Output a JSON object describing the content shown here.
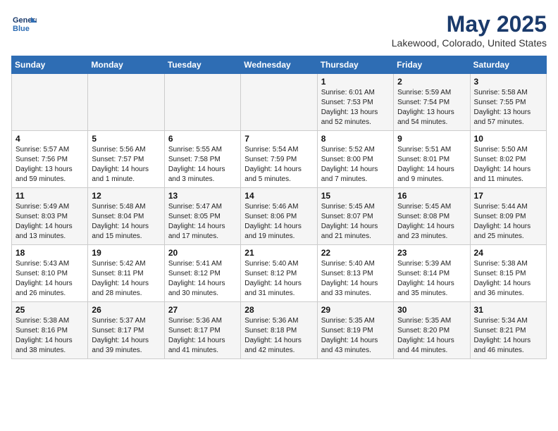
{
  "header": {
    "logo_line1": "General",
    "logo_line2": "Blue",
    "title": "May 2025",
    "subtitle": "Lakewood, Colorado, United States"
  },
  "days_of_week": [
    "Sunday",
    "Monday",
    "Tuesday",
    "Wednesday",
    "Thursday",
    "Friday",
    "Saturday"
  ],
  "weeks": [
    [
      {
        "day": "",
        "info": ""
      },
      {
        "day": "",
        "info": ""
      },
      {
        "day": "",
        "info": ""
      },
      {
        "day": "",
        "info": ""
      },
      {
        "day": "1",
        "info": "Sunrise: 6:01 AM\nSunset: 7:53 PM\nDaylight: 13 hours\nand 52 minutes."
      },
      {
        "day": "2",
        "info": "Sunrise: 5:59 AM\nSunset: 7:54 PM\nDaylight: 13 hours\nand 54 minutes."
      },
      {
        "day": "3",
        "info": "Sunrise: 5:58 AM\nSunset: 7:55 PM\nDaylight: 13 hours\nand 57 minutes."
      }
    ],
    [
      {
        "day": "4",
        "info": "Sunrise: 5:57 AM\nSunset: 7:56 PM\nDaylight: 13 hours\nand 59 minutes."
      },
      {
        "day": "5",
        "info": "Sunrise: 5:56 AM\nSunset: 7:57 PM\nDaylight: 14 hours\nand 1 minute."
      },
      {
        "day": "6",
        "info": "Sunrise: 5:55 AM\nSunset: 7:58 PM\nDaylight: 14 hours\nand 3 minutes."
      },
      {
        "day": "7",
        "info": "Sunrise: 5:54 AM\nSunset: 7:59 PM\nDaylight: 14 hours\nand 5 minutes."
      },
      {
        "day": "8",
        "info": "Sunrise: 5:52 AM\nSunset: 8:00 PM\nDaylight: 14 hours\nand 7 minutes."
      },
      {
        "day": "9",
        "info": "Sunrise: 5:51 AM\nSunset: 8:01 PM\nDaylight: 14 hours\nand 9 minutes."
      },
      {
        "day": "10",
        "info": "Sunrise: 5:50 AM\nSunset: 8:02 PM\nDaylight: 14 hours\nand 11 minutes."
      }
    ],
    [
      {
        "day": "11",
        "info": "Sunrise: 5:49 AM\nSunset: 8:03 PM\nDaylight: 14 hours\nand 13 minutes."
      },
      {
        "day": "12",
        "info": "Sunrise: 5:48 AM\nSunset: 8:04 PM\nDaylight: 14 hours\nand 15 minutes."
      },
      {
        "day": "13",
        "info": "Sunrise: 5:47 AM\nSunset: 8:05 PM\nDaylight: 14 hours\nand 17 minutes."
      },
      {
        "day": "14",
        "info": "Sunrise: 5:46 AM\nSunset: 8:06 PM\nDaylight: 14 hours\nand 19 minutes."
      },
      {
        "day": "15",
        "info": "Sunrise: 5:45 AM\nSunset: 8:07 PM\nDaylight: 14 hours\nand 21 minutes."
      },
      {
        "day": "16",
        "info": "Sunrise: 5:45 AM\nSunset: 8:08 PM\nDaylight: 14 hours\nand 23 minutes."
      },
      {
        "day": "17",
        "info": "Sunrise: 5:44 AM\nSunset: 8:09 PM\nDaylight: 14 hours\nand 25 minutes."
      }
    ],
    [
      {
        "day": "18",
        "info": "Sunrise: 5:43 AM\nSunset: 8:10 PM\nDaylight: 14 hours\nand 26 minutes."
      },
      {
        "day": "19",
        "info": "Sunrise: 5:42 AM\nSunset: 8:11 PM\nDaylight: 14 hours\nand 28 minutes."
      },
      {
        "day": "20",
        "info": "Sunrise: 5:41 AM\nSunset: 8:12 PM\nDaylight: 14 hours\nand 30 minutes."
      },
      {
        "day": "21",
        "info": "Sunrise: 5:40 AM\nSunset: 8:12 PM\nDaylight: 14 hours\nand 31 minutes."
      },
      {
        "day": "22",
        "info": "Sunrise: 5:40 AM\nSunset: 8:13 PM\nDaylight: 14 hours\nand 33 minutes."
      },
      {
        "day": "23",
        "info": "Sunrise: 5:39 AM\nSunset: 8:14 PM\nDaylight: 14 hours\nand 35 minutes."
      },
      {
        "day": "24",
        "info": "Sunrise: 5:38 AM\nSunset: 8:15 PM\nDaylight: 14 hours\nand 36 minutes."
      }
    ],
    [
      {
        "day": "25",
        "info": "Sunrise: 5:38 AM\nSunset: 8:16 PM\nDaylight: 14 hours\nand 38 minutes."
      },
      {
        "day": "26",
        "info": "Sunrise: 5:37 AM\nSunset: 8:17 PM\nDaylight: 14 hours\nand 39 minutes."
      },
      {
        "day": "27",
        "info": "Sunrise: 5:36 AM\nSunset: 8:17 PM\nDaylight: 14 hours\nand 41 minutes."
      },
      {
        "day": "28",
        "info": "Sunrise: 5:36 AM\nSunset: 8:18 PM\nDaylight: 14 hours\nand 42 minutes."
      },
      {
        "day": "29",
        "info": "Sunrise: 5:35 AM\nSunset: 8:19 PM\nDaylight: 14 hours\nand 43 minutes."
      },
      {
        "day": "30",
        "info": "Sunrise: 5:35 AM\nSunset: 8:20 PM\nDaylight: 14 hours\nand 44 minutes."
      },
      {
        "day": "31",
        "info": "Sunrise: 5:34 AM\nSunset: 8:21 PM\nDaylight: 14 hours\nand 46 minutes."
      }
    ]
  ]
}
